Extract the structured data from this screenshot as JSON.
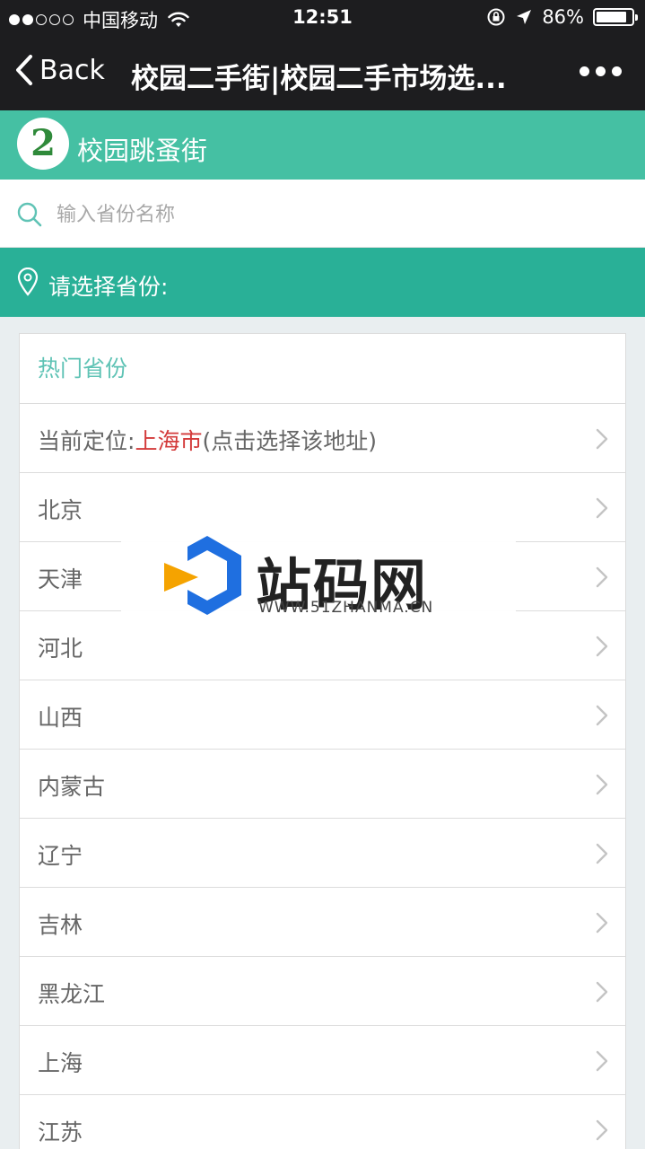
{
  "status_bar": {
    "carrier": "中国移动",
    "time": "12:51",
    "battery_percent": "86%",
    "battery_level": 0.86,
    "signal_bars_filled": 2,
    "signal_bars_total": 5
  },
  "nav": {
    "back_label": "Back",
    "title": "校园二手街|校园二手市场选..."
  },
  "app": {
    "name": "校园跳蚤街",
    "logo_text": "2"
  },
  "search": {
    "placeholder": "输入省份名称",
    "value": ""
  },
  "select_bar": {
    "label": "请选择省份:"
  },
  "list": {
    "header": "热门省份",
    "current_location": {
      "prefix": "当前定位:",
      "city": "上海市",
      "suffix": "(点击选择该地址)"
    },
    "provinces": [
      "北京",
      "天津",
      "河北",
      "山西",
      "内蒙古",
      "辽宁",
      "吉林",
      "黑龙江",
      "上海",
      "江苏"
    ]
  },
  "watermark": {
    "title": "站码网",
    "url": "WWW.51ZHANMA.CN"
  },
  "colors": {
    "bar_dark": "#1d1d1f",
    "header_green": "#45c0a3",
    "select_green": "#29b097",
    "list_header_text": "#5fc3b5",
    "location_red": "#d33a3a"
  },
  "icons": {
    "search": "search-icon",
    "location": "location-pin-icon",
    "chevron": "chevron-right-icon",
    "back": "chevron-left-icon",
    "more": "more-dots-icon"
  }
}
